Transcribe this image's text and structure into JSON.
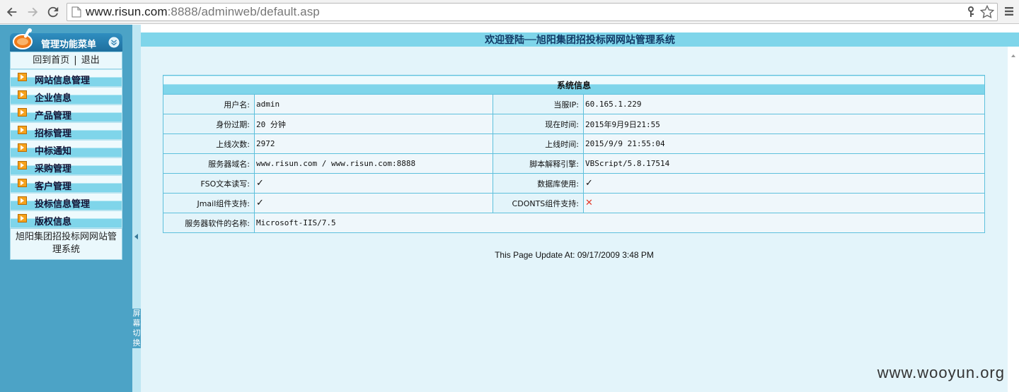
{
  "browser": {
    "url_host": "www.risun.com",
    "url_rest": ":8888/adminweb/default.asp",
    "icons": {
      "back": "back-arrow-icon",
      "forward": "forward-arrow-icon",
      "reload": "reload-icon",
      "page": "page-icon",
      "key": "key-icon",
      "star": "star-icon",
      "menu": "hamburger-menu-icon"
    }
  },
  "sidebar": {
    "title": "管理功能菜单",
    "links": {
      "home": "回到首页",
      "separator": "|",
      "logout": "退出"
    },
    "items": [
      {
        "label": "网站信息管理"
      },
      {
        "label": "企业信息"
      },
      {
        "label": "产品管理"
      },
      {
        "label": "招标管理"
      },
      {
        "label": "中标通知"
      },
      {
        "label": "采购管理"
      },
      {
        "label": "客户管理"
      },
      {
        "label": "投标信息管理"
      },
      {
        "label": "版权信息"
      }
    ],
    "footer": "旭阳集团招投标网网站管理系统",
    "toggle_label": "屏幕切换",
    "colors": {
      "sidebar_bg": "#4ca3c6",
      "header": "#2f8ec0",
      "item_band": "#7fd5ea"
    }
  },
  "main": {
    "banner": "欢迎登陆──旭阳集团招投标网网站管理系统",
    "table": {
      "caption": "系统信息",
      "rows": [
        {
          "k1": "用户名:",
          "v1": "admin",
          "k2": "当服IP:",
          "v2": "60.165.1.229"
        },
        {
          "k1": "身份过期:",
          "v1": "20 分钟",
          "k2": "现在时间:",
          "v2": "2015年9月9日21:55"
        },
        {
          "k1": "上线次数:",
          "v1": "2972",
          "k2": "上线时间:",
          "v2": "2015/9/9 21:55:04"
        },
        {
          "k1": "服务器域名:",
          "v1": "www.risun.com / www.risun.com:8888",
          "k2": "脚本解释引擎:",
          "v2": "VBScript/5.8.17514"
        },
        {
          "k1": "FSO文本读写:",
          "v1": "✓",
          "k2": "数据库使用:",
          "v2": "✓"
        },
        {
          "k1": "Jmail组件支持:",
          "v1": "✓",
          "k2": "CDONTS组件支持:",
          "v2": "✕"
        }
      ],
      "last_row": {
        "k": "服务器软件的名称:",
        "v": "Microsoft-IIS/7.5"
      }
    },
    "update_text": "This Page Update At: 09/17/2009 3:48 PM"
  },
  "watermark": "www.wooyun.org"
}
